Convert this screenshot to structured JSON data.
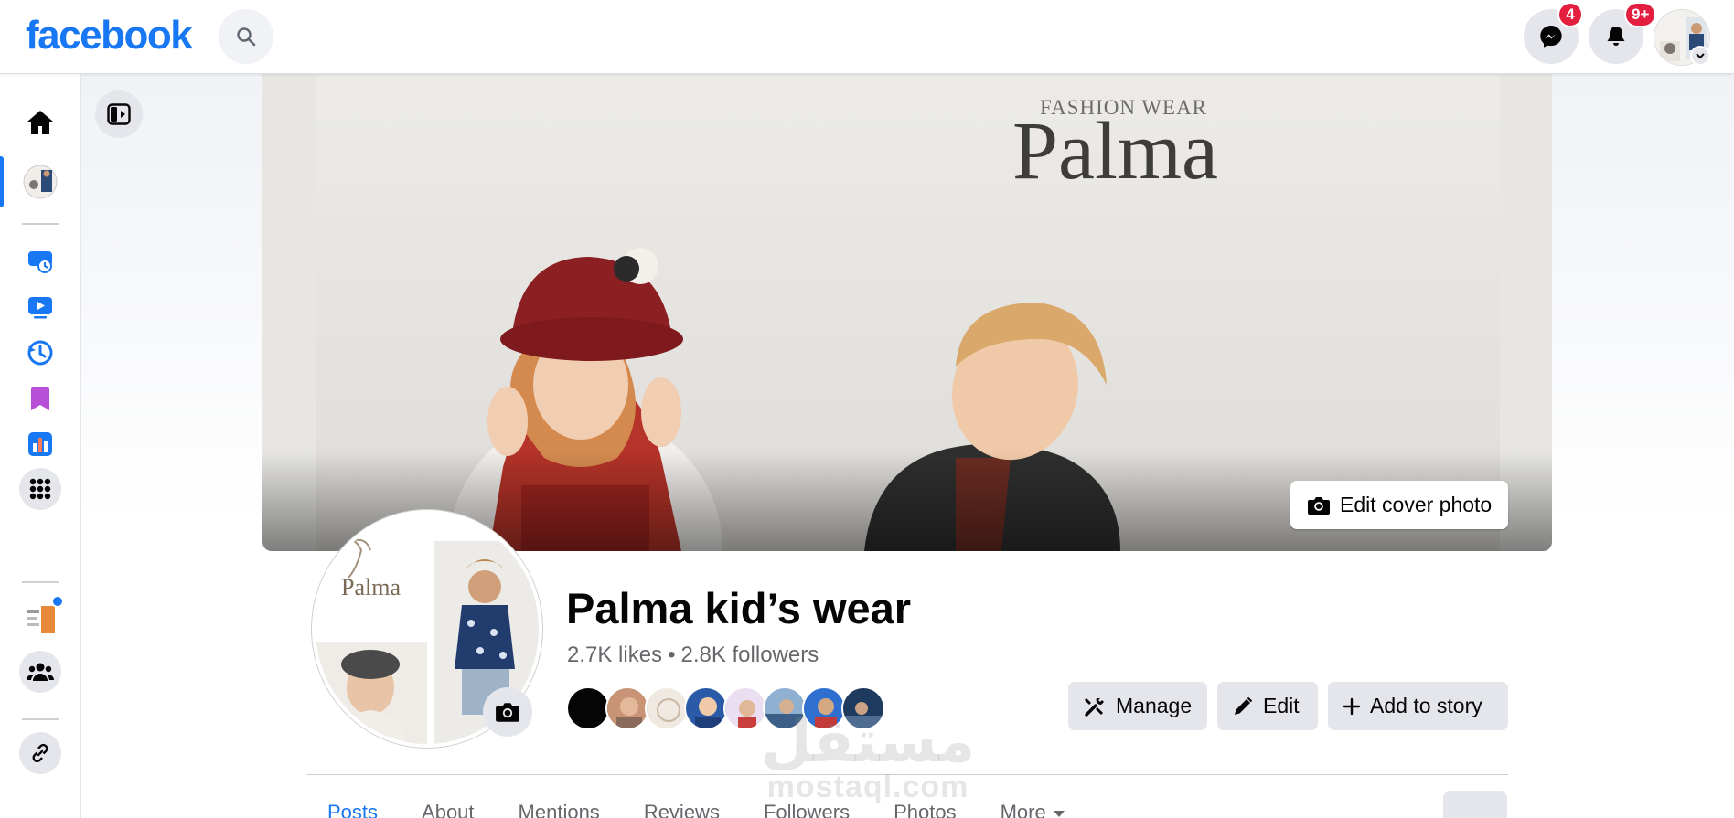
{
  "app": {
    "logo": "facebook"
  },
  "header": {
    "search_icon": "search-icon",
    "messenger": {
      "icon": "messenger-icon",
      "badge": "4"
    },
    "notifications": {
      "icon": "bell-icon",
      "badge": "9+"
    }
  },
  "rail": {
    "items": [
      {
        "name": "home",
        "icon": "home-icon"
      },
      {
        "name": "page-profile",
        "icon": "page-avatar"
      },
      {
        "name": "meta-business-suite",
        "icon": "business-suite-icon"
      },
      {
        "name": "video",
        "icon": "video-icon"
      },
      {
        "name": "memories",
        "icon": "clock-icon"
      },
      {
        "name": "saved",
        "icon": "bookmark-icon"
      },
      {
        "name": "insights",
        "icon": "chart-icon"
      },
      {
        "name": "all-apps",
        "icon": "grid-dots-icon"
      },
      {
        "name": "page-shortcut",
        "icon": "shortcut-avatar"
      },
      {
        "name": "groups",
        "icon": "groups-icon"
      },
      {
        "name": "link",
        "icon": "link-icon"
      }
    ]
  },
  "cover": {
    "brand_text": "Palma",
    "brand_tagline": "FASHION WEAR",
    "edit_cover_label": "Edit cover photo"
  },
  "profile": {
    "pic_brand": "Palma",
    "page_name": "Palma kid’s wear",
    "likes": "2.7K likes",
    "followers": "2.8K followers",
    "separator": "•"
  },
  "actions": {
    "manage_label": "Manage",
    "edit_label": "Edit",
    "add_story_label": "Add to story"
  },
  "tabs": [
    {
      "label": "Posts",
      "active": true
    },
    {
      "label": "About"
    },
    {
      "label": "Mentions"
    },
    {
      "label": "Reviews"
    },
    {
      "label": "Followers"
    },
    {
      "label": "Photos"
    },
    {
      "label": "More"
    }
  ],
  "overflow_label": "...",
  "watermark": {
    "arabic": "مستقل",
    "latin": "mostaql.com"
  },
  "colors": {
    "brand_blue": "#1877f2",
    "badge_red": "#e41e3f",
    "button_gray": "#e4e6eb"
  }
}
